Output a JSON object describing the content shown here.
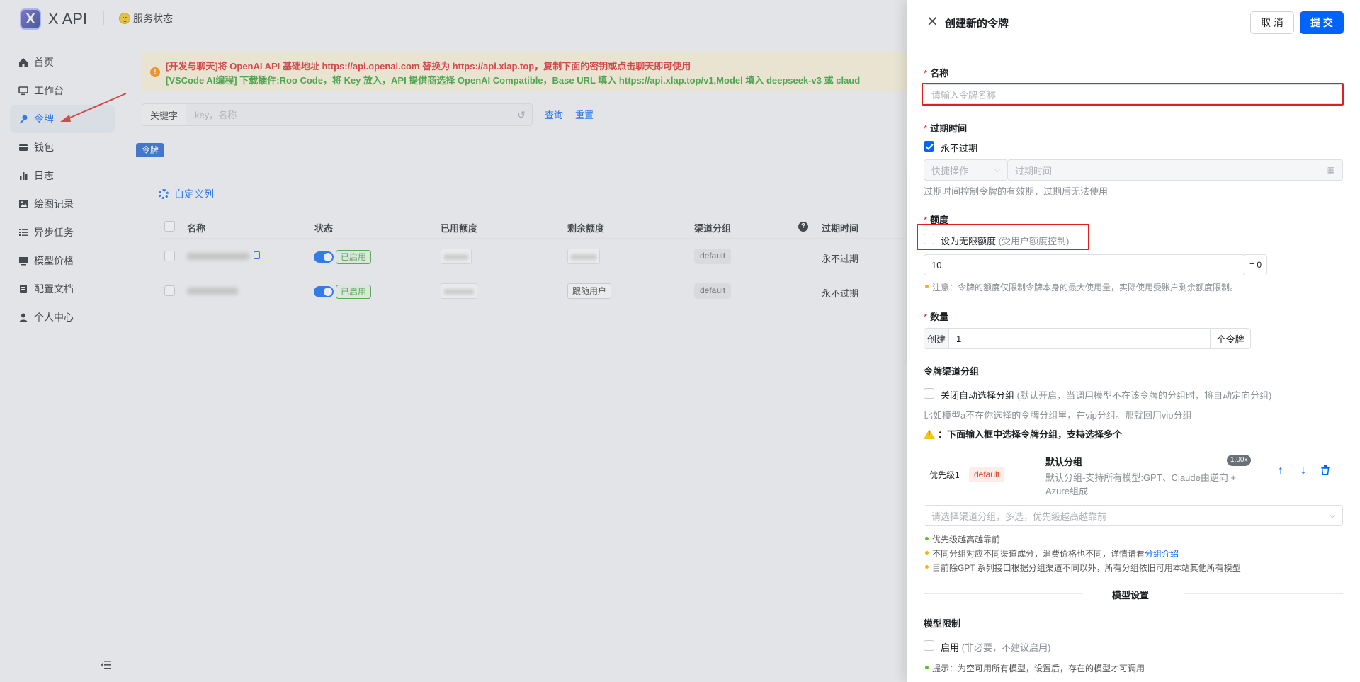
{
  "app": {
    "title": "X API",
    "logo_letter": "X",
    "status_link": "服务状态"
  },
  "sidebar": {
    "items": [
      {
        "label": "首页",
        "icon": "home-icon"
      },
      {
        "label": "工作台",
        "icon": "monitor-icon"
      },
      {
        "label": "令牌",
        "icon": "key-icon",
        "active": true
      },
      {
        "label": "钱包",
        "icon": "wallet-icon"
      },
      {
        "label": "日志",
        "icon": "bar-chart-icon"
      },
      {
        "label": "绘图记录",
        "icon": "image-icon"
      },
      {
        "label": "异步任务",
        "icon": "task-list-icon"
      },
      {
        "label": "模型价格",
        "icon": "price-icon"
      },
      {
        "label": "配置文档",
        "icon": "document-icon"
      },
      {
        "label": "个人中心",
        "icon": "user-icon"
      }
    ],
    "collapse_icon": "collapse-sidebar-icon"
  },
  "banner": {
    "line1": "[开发与聊天]将 OpenAI API 基础地址 https://api.openai.com 替换为 https://api.xlap.top，复制下面的密钥或点击聊天即可使用",
    "line2": "[VSCode AI编程] 下载插件:Roo Code，将 Key 放入，API 提供商选择 OpenAI Compatible，Base URL 填入 https://api.xlap.top/v1,Model 填入 deepseek-v3 或 claud",
    "colors": {
      "line1": "#e02020",
      "line2": "#2a9d2a",
      "background": "#fef6dc"
    }
  },
  "search": {
    "label": "关键字",
    "placeholder": "key，名称",
    "query_button": "查询",
    "reset_button": "重置"
  },
  "tokens_tag": "令牌",
  "table": {
    "custom_columns": "自定义列",
    "headers": [
      "名称",
      "状态",
      "已用额度",
      "剩余额度",
      "渠道分组",
      "过期时间"
    ],
    "rows": [
      {
        "status": "已启用",
        "remaining": "",
        "group": "default",
        "expires": "永不过期"
      },
      {
        "status": "已启用",
        "remaining": "跟随用户",
        "group": "default",
        "expires": "永不过期"
      }
    ]
  },
  "drawer": {
    "title": "创建新的令牌",
    "cancel": "取 消",
    "submit": "提 交",
    "name": {
      "label": "名称",
      "placeholder": "请输入令牌名称"
    },
    "expiry": {
      "label": "过期时间",
      "never_expire": "永不过期",
      "never_expire_checked": true,
      "quick_action_placeholder": "快捷操作",
      "time_placeholder": "过期时间",
      "help": "过期时间控制令牌的有效期，过期后无法使用"
    },
    "quota": {
      "label": "额度",
      "unlimited_label": "设为无限额度",
      "unlimited_hint": "(受用户额度控制)",
      "unlimited_checked": false,
      "value": "10",
      "equals": "= 0",
      "note": "注意：令牌的额度仅限制令牌本身的最大使用量，实际使用受账户剩余额度限制。"
    },
    "count": {
      "label": "数量",
      "prefix": "创建",
      "value": "1",
      "suffix": "个令牌"
    },
    "channel_group": {
      "label": "令牌渠道分组",
      "auto_select_label": "关闭自动选择分组",
      "auto_select_hint": "(默认开启，当调用模型不在该令牌的分组时，将自动定向分组)",
      "example": "比如模型a不在你选择的令牌分组里，在vip分组。那就回用vip分组",
      "warning": "：下面输入框中选择令牌分组，支持选择多个",
      "selected": {
        "priority": "优先级1",
        "tag": "default",
        "name": "默认分组",
        "ratio": "1.00x",
        "desc_line1": "默认分组-支持所有模型:GPT、Claude由逆向 +",
        "desc_line2": "Azure组成"
      },
      "select_placeholder": "请选择渠道分组，多选，优先级越高越靠前",
      "tips": [
        {
          "text": "优先级越高越靠前",
          "color": "#52c41a"
        },
        {
          "text": "不同分组对应不同渠道成分，消费价格也不同，详情请看",
          "link": "分组介绍",
          "color": "#faad14"
        },
        {
          "text": "目前除GPT 系列接口根据分组渠道不同以外，所有分组依旧可用本站其他所有模型",
          "color": "#faad14"
        }
      ]
    },
    "model_section": "模型设置",
    "model_limit": {
      "label": "模型限制",
      "enable_label": "启用",
      "enable_hint": "(非必要，不建议启用)",
      "tip": "提示：为空可用所有模型，设置后，存在的模型才可调用"
    }
  }
}
